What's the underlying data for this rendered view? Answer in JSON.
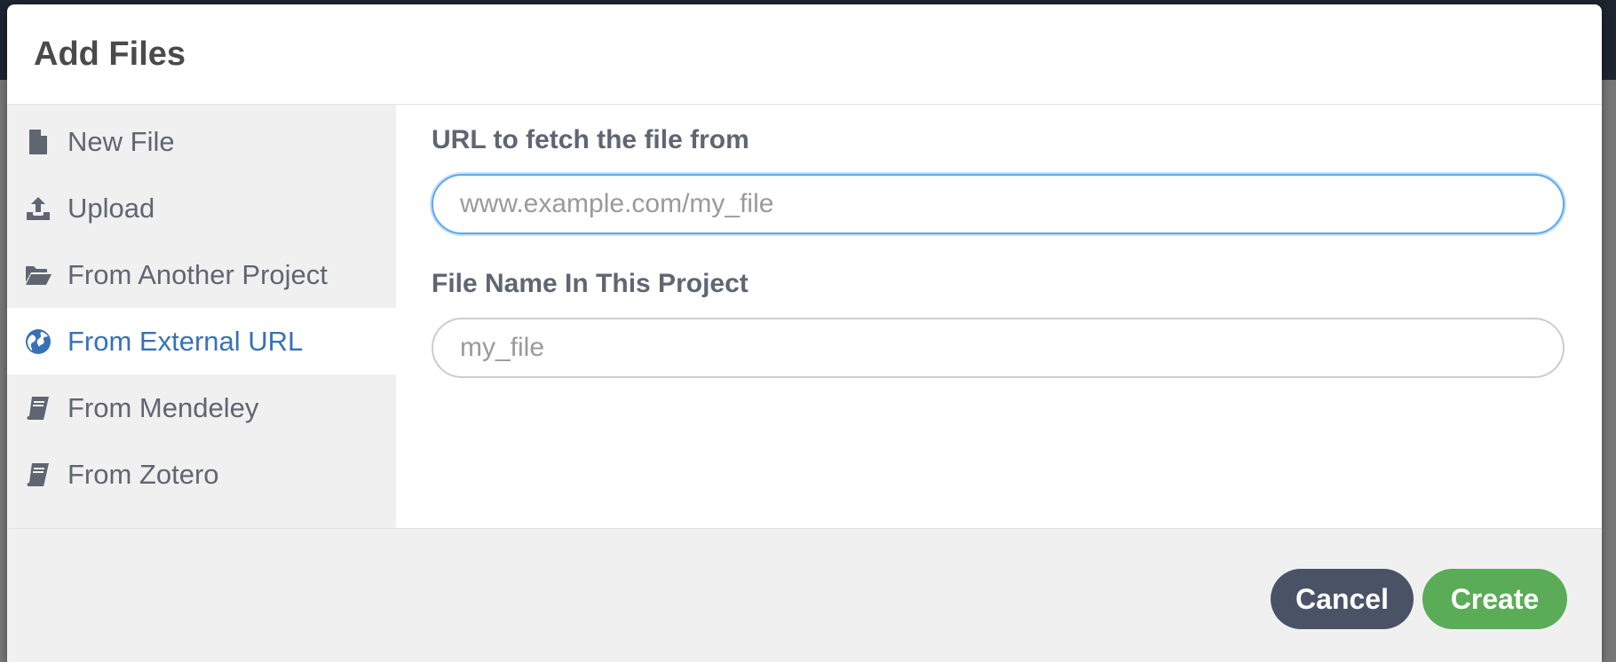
{
  "modal": {
    "title": "Add Files"
  },
  "sidebar": {
    "items": [
      {
        "label": "New File",
        "icon": "file-icon",
        "active": false
      },
      {
        "label": "Upload",
        "icon": "upload-icon",
        "active": false
      },
      {
        "label": "From Another Project",
        "icon": "folder-open-icon",
        "active": false
      },
      {
        "label": "From External URL",
        "icon": "globe-icon",
        "active": true
      },
      {
        "label": "From Mendeley",
        "icon": "book-icon",
        "active": false
      },
      {
        "label": "From Zotero",
        "icon": "book-icon",
        "active": false
      }
    ]
  },
  "form": {
    "url_label": "URL to fetch the file from",
    "url_placeholder": "www.example.com/my_file",
    "url_value": "",
    "name_label": "File Name In This Project",
    "name_placeholder": "my_file",
    "name_value": ""
  },
  "footer": {
    "cancel_label": "Cancel",
    "create_label": "Create"
  },
  "colors": {
    "accent": "#3971b4",
    "create_button": "#5aac56",
    "cancel_button": "#4a5366",
    "focus_ring": "#5fa8e8"
  }
}
